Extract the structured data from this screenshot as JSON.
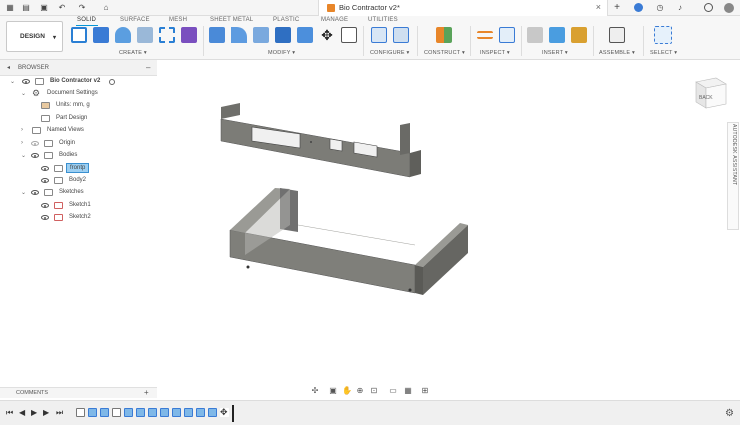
{
  "window": {
    "title": "Bio Contractor v2*"
  },
  "workspace_tabs": [
    "SOLID",
    "SURFACE",
    "MESH",
    "SHEET METAL",
    "PLASTIC",
    "MANAGE",
    "UTILITIES"
  ],
  "design_button": "DESIGN",
  "groups": {
    "create": "CREATE ▾",
    "modify": "MODIFY ▾",
    "configure": "CONFIGURE ▾",
    "construct": "CONSTRUCT ▾",
    "inspect": "INSPECT ▾",
    "insert": "INSERT ▾",
    "assemble": "ASSEMBLE ▾",
    "select": "SELECT ▾"
  },
  "browser": {
    "title": "BROWSER",
    "root": "Bio Contractor v2",
    "document_settings": "Document Settings",
    "units": "Units: mm, g",
    "part_design": "Part Design",
    "named_views": "Named Views",
    "origin": "Origin",
    "bodies": "Bodies",
    "body1": "frontp",
    "body2": "Body2",
    "sketches": "Sketches",
    "sketch1": "Sketch1",
    "sketch2": "Sketch2"
  },
  "comments": "COMMENTS",
  "viewcube": {
    "face": "BACK"
  },
  "assistant": "AUTODESK ASSISTANT",
  "colors": {
    "accent": "#0696d7",
    "model": "#7a7a76",
    "selected": "#9ccff2"
  }
}
